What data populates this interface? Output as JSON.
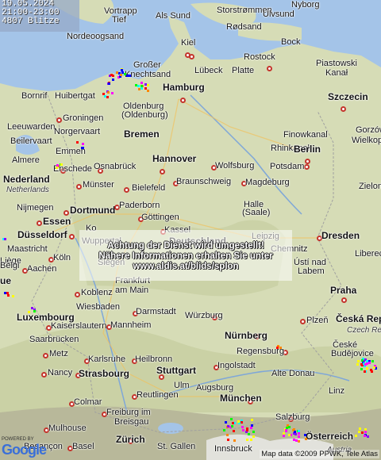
{
  "info": {
    "date": "19.05.2024",
    "time": "21:00-23:00",
    "count": "4807 Blitze"
  },
  "notice": {
    "line1": "Achtung der Dienst wird umgestellt!",
    "line2": "Nähere Informationen erhalten Sie unter",
    "line3": "www.aldis.at/blids/splon"
  },
  "copyright": "Map data ©2009 PPWK, Tele Atlas",
  "logo": {
    "powered": "POWERED BY",
    "brand": "Google"
  },
  "colors": {
    "water": "#a4c4e8",
    "land": "#d6dcb6",
    "city_border": "#c4342c",
    "text_overlay": "#ffffff"
  },
  "cities": [
    {
      "name": "Vortrapp",
      "style": "normal"
    },
    {
      "name": "Tief",
      "style": "normal"
    },
    {
      "name": "Als Sund",
      "style": "normal"
    },
    {
      "name": "Storstrømmen",
      "style": "normal"
    },
    {
      "name": "Ulvsund",
      "style": "normal"
    },
    {
      "name": "Nyborg",
      "style": "normal"
    },
    {
      "name": "Nordeoogsand",
      "style": "normal"
    },
    {
      "name": "Rødsand",
      "style": "normal"
    },
    {
      "name": "Kiel",
      "style": "normal"
    },
    {
      "name": "Bock",
      "style": "normal"
    },
    {
      "name": "Rostock",
      "style": "normal"
    },
    {
      "name": "Großer",
      "style": "normal"
    },
    {
      "name": "Knechtsand",
      "style": "normal"
    },
    {
      "name": "Lübeck",
      "style": "normal"
    },
    {
      "name": "Platte",
      "style": "normal"
    },
    {
      "name": "Piastowski",
      "style": "normal"
    },
    {
      "name": "Kanał",
      "style": "normal"
    },
    {
      "name": "Bornrif",
      "style": "normal"
    },
    {
      "name": "Huibertgat",
      "style": "normal"
    },
    {
      "name": "Hamburg",
      "style": "bold"
    },
    {
      "name": "Szczecin",
      "style": "bold"
    },
    {
      "name": "Oldenburg",
      "style": "normal"
    },
    {
      "name": "(Oldenburg)",
      "style": "normal"
    },
    {
      "name": "Groningen",
      "style": "normal"
    },
    {
      "name": "Leeuwarden",
      "style": "normal"
    },
    {
      "name": "Norgervaart",
      "style": "normal"
    },
    {
      "name": "Bremen",
      "style": "bold"
    },
    {
      "name": "Finowkanal",
      "style": "normal"
    },
    {
      "name": "Gorzów",
      "style": "normal"
    },
    {
      "name": "Wielkopo",
      "style": "normal"
    },
    {
      "name": "Beilervaart",
      "style": "normal"
    },
    {
      "name": "Emmen",
      "style": "normal"
    },
    {
      "name": "Rhinkanal",
      "style": "normal"
    },
    {
      "name": "Berlin",
      "style": "bold"
    },
    {
      "name": "Almere",
      "style": "normal"
    },
    {
      "name": "Enschede",
      "style": "normal"
    },
    {
      "name": "Osnabrück",
      "style": "normal"
    },
    {
      "name": "Hannover",
      "style": "bold"
    },
    {
      "name": "Wolfsburg",
      "style": "normal"
    },
    {
      "name": "Potsdam",
      "style": "normal"
    },
    {
      "name": "Nederland",
      "style": "bold"
    },
    {
      "name": "Netherlands",
      "style": "ital"
    },
    {
      "name": "Münster",
      "style": "normal"
    },
    {
      "name": "Bielefeld",
      "style": "normal"
    },
    {
      "name": "Braunschweig",
      "style": "normal"
    },
    {
      "name": "Magdeburg",
      "style": "normal"
    },
    {
      "name": "Zielona",
      "style": "normal"
    },
    {
      "name": "Nijmegen",
      "style": "normal"
    },
    {
      "name": "Dortmund",
      "style": "bold"
    },
    {
      "name": "Paderborn",
      "style": "normal"
    },
    {
      "name": "Göttingen",
      "style": "normal"
    },
    {
      "name": "Halle",
      "style": "normal"
    },
    {
      "name": "(Saale)",
      "style": "normal"
    },
    {
      "name": "Essen",
      "style": "bold"
    },
    {
      "name": "Kassel",
      "style": "normal"
    },
    {
      "name": "Düsseldorf",
      "style": "bold"
    },
    {
      "name": "Wuppertal",
      "style": "normal"
    },
    {
      "name": "Deutschland",
      "style": "bold"
    },
    {
      "name": "Leipzig",
      "style": "normal"
    },
    {
      "name": "Dresden",
      "style": "bold"
    },
    {
      "name": "Maastricht",
      "style": "normal"
    },
    {
      "name": "Köln",
      "style": "normal"
    },
    {
      "name": "Chemnitz",
      "style": "normal"
    },
    {
      "name": "Liberec",
      "style": "normal"
    },
    {
      "name": "Liège",
      "style": "normal"
    },
    {
      "name": "Aachen",
      "style": "normal"
    },
    {
      "name": "Siegen",
      "style": "normal"
    },
    {
      "name": "Ústí nad",
      "style": "normal"
    },
    {
      "name": "Labem",
      "style": "normal"
    },
    {
      "name": "Frankfurt",
      "style": "normal"
    },
    {
      "name": "am Main",
      "style": "normal"
    },
    {
      "name": "Koblenz",
      "style": "normal"
    },
    {
      "name": "Praha",
      "style": "bold"
    },
    {
      "name": "Wiesbaden",
      "style": "normal"
    },
    {
      "name": "Luxembourg",
      "style": "bold"
    },
    {
      "name": "Darmstadt",
      "style": "normal"
    },
    {
      "name": "Würzburg",
      "style": "normal"
    },
    {
      "name": "Plzeň",
      "style": "normal"
    },
    {
      "name": "Česká Rep",
      "style": "bold"
    },
    {
      "name": "Czech Re",
      "style": "ital"
    },
    {
      "name": "Kaiserslautern",
      "style": "normal"
    },
    {
      "name": "Mannheim",
      "style": "normal"
    },
    {
      "name": "Saarbrücken",
      "style": "normal"
    },
    {
      "name": "Nürnberg",
      "style": "bold"
    },
    {
      "name": "Metz",
      "style": "normal"
    },
    {
      "name": "Karlsruhe",
      "style": "normal"
    },
    {
      "name": "Heilbronn",
      "style": "normal"
    },
    {
      "name": "Regensburg",
      "style": "normal"
    },
    {
      "name": "České",
      "style": "normal"
    },
    {
      "name": "Budějovice",
      "style": "normal"
    },
    {
      "name": "Nancy",
      "style": "normal"
    },
    {
      "name": "Strasbourg",
      "style": "bold"
    },
    {
      "name": "Stuttgart",
      "style": "bold"
    },
    {
      "name": "Ingolstadt",
      "style": "normal"
    },
    {
      "name": "Alte Donau",
      "style": "normal"
    },
    {
      "name": "Ulm",
      "style": "normal"
    },
    {
      "name": "Augsburg",
      "style": "normal"
    },
    {
      "name": "Reutlingen",
      "style": "normal"
    },
    {
      "name": "Linz",
      "style": "normal"
    },
    {
      "name": "Colmar",
      "style": "normal"
    },
    {
      "name": "Freiburg im",
      "style": "normal"
    },
    {
      "name": "Breisgau",
      "style": "normal"
    },
    {
      "name": "München",
      "style": "bold"
    },
    {
      "name": "Mulhouse",
      "style": "normal"
    },
    {
      "name": "Salzburg",
      "style": "normal"
    },
    {
      "name": "Besançon",
      "style": "normal"
    },
    {
      "name": "Basel",
      "style": "normal"
    },
    {
      "name": "Zürich",
      "style": "bold"
    },
    {
      "name": "St. Gallen",
      "style": "normal"
    },
    {
      "name": "Innsbruck",
      "style": "normal"
    },
    {
      "name": "Österreich",
      "style": "bold"
    },
    {
      "name": "Austria",
      "style": "ital"
    },
    {
      "name": "Belgi",
      "style": "normal"
    },
    {
      "name": "Ko",
      "style": "normal"
    },
    {
      "name": "ue",
      "style": "bold"
    }
  ]
}
